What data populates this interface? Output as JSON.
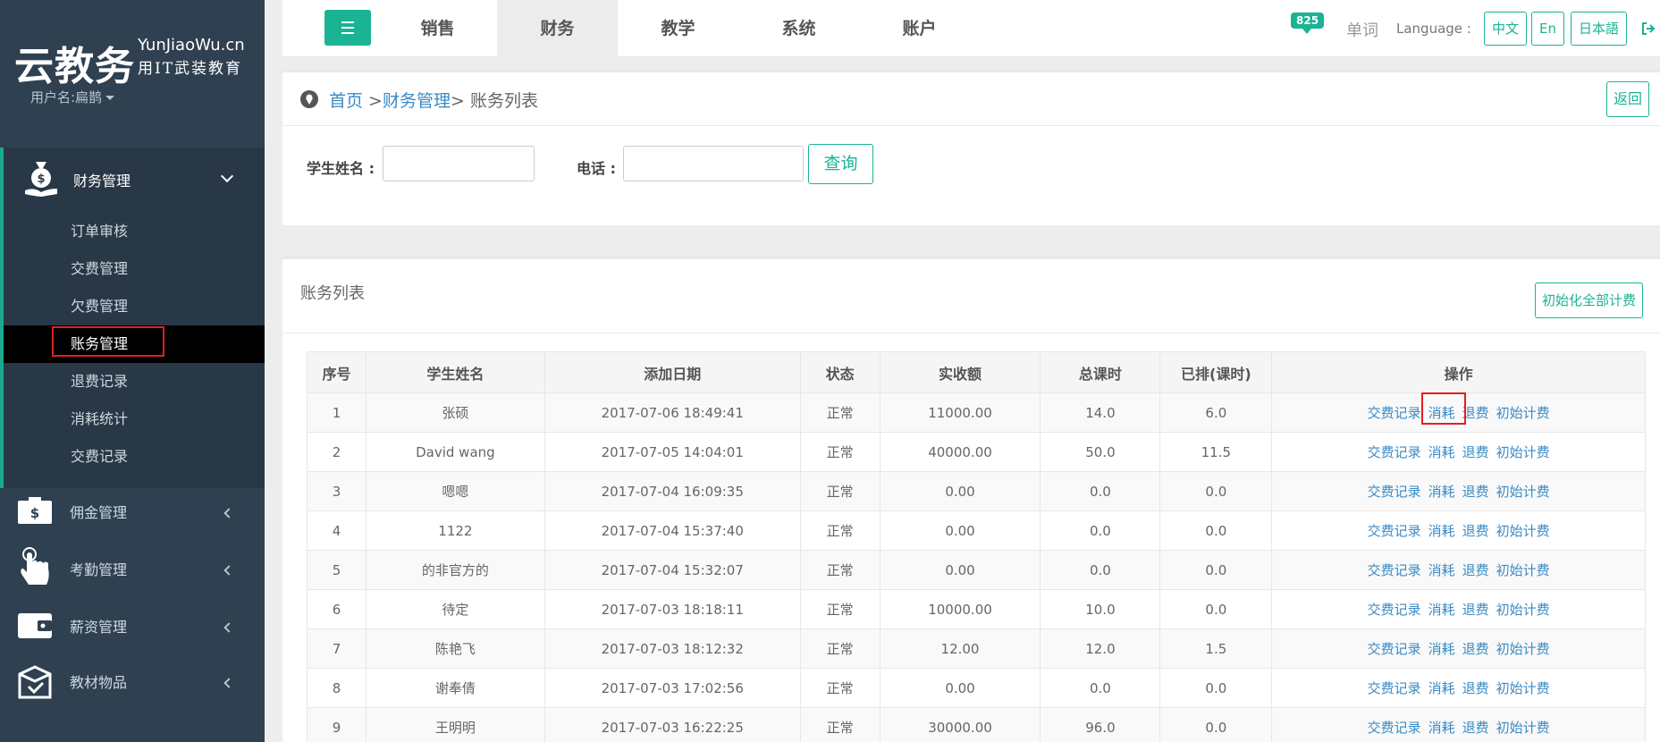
{
  "brand": {
    "main": "云教务",
    "sub1": "YunJiaoWu.cn",
    "sub2": "用IT武装教育",
    "user": "用户名:扁鹊"
  },
  "sidebar": {
    "active_section": "财务管理",
    "sub_items": [
      "订单审核",
      "交费管理",
      "欠费管理",
      "账务管理",
      "退费记录",
      "消耗统计",
      "交费记录"
    ],
    "other_sections": [
      "佣金管理",
      "考勤管理",
      "薪资管理",
      "教材物品"
    ]
  },
  "topbar": {
    "tabs": [
      "销售",
      "财务",
      "教学",
      "系统",
      "账户"
    ],
    "badge": "825",
    "word": "单词",
    "language_label": "Language :",
    "languages": [
      "中文",
      "En",
      "日本語"
    ]
  },
  "breadcrumb": {
    "home": "首页",
    "sep1": " >",
    "section": "财务管理",
    "rest": "> 账务列表",
    "back": "返回"
  },
  "search": {
    "name_label": "学生姓名 :",
    "name_value": "",
    "phone_label": "电话 :",
    "phone_value": "",
    "query": "查询"
  },
  "list": {
    "title": "账务列表",
    "init_all": "初始化全部计费",
    "headers": [
      "序号",
      "学生姓名",
      "添加日期",
      "状态",
      "实收额",
      "总课时",
      "已排(课时)",
      "操作"
    ],
    "actions": [
      "交费记录",
      "消耗",
      "退费",
      "初始计费"
    ],
    "rows": [
      [
        "1",
        "张硕",
        "2017-07-06 18:49:41",
        "正常",
        "11000.00",
        "14.0",
        "6.0"
      ],
      [
        "2",
        "David wang",
        "2017-07-05 14:04:01",
        "正常",
        "40000.00",
        "50.0",
        "11.5"
      ],
      [
        "3",
        "嗯嗯",
        "2017-07-04 16:09:35",
        "正常",
        "0.00",
        "0.0",
        "0.0"
      ],
      [
        "4",
        "1122",
        "2017-07-04 15:37:40",
        "正常",
        "0.00",
        "0.0",
        "0.0"
      ],
      [
        "5",
        "的非官方的",
        "2017-07-04 15:32:07",
        "正常",
        "0.00",
        "0.0",
        "0.0"
      ],
      [
        "6",
        "待定",
        "2017-07-03 18:18:11",
        "正常",
        "10000.00",
        "10.0",
        "0.0"
      ],
      [
        "7",
        "陈艳飞",
        "2017-07-03 18:12:32",
        "正常",
        "12.00",
        "12.0",
        "1.5"
      ],
      [
        "8",
        "谢奉倩",
        "2017-07-03 17:02:56",
        "正常",
        "0.00",
        "0.0",
        "0.0"
      ],
      [
        "9",
        "王明明",
        "2017-07-03 16:22:25",
        "正常",
        "30000.00",
        "96.0",
        "0.0"
      ]
    ]
  },
  "colors": {
    "accent": "#1ab394",
    "sidebar_bg": "#2f4050",
    "link": "#3a8ac4",
    "highlight": "#e02020"
  }
}
